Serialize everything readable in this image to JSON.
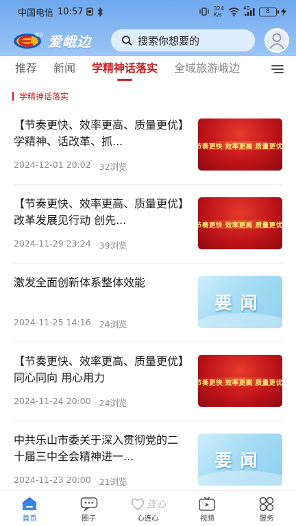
{
  "status_bar": {
    "carrier": "中国电信",
    "time": "10:57",
    "network_speed_top": "324",
    "network_speed_bottom": "K/s",
    "signal_label": "4G",
    "battery": "8"
  },
  "app": {
    "logo_text": "爱峨边",
    "search_placeholder": "搜索你想要的"
  },
  "tabs": [
    {
      "label": "推荐"
    },
    {
      "label": "新闻"
    },
    {
      "label": "学精神话落实"
    },
    {
      "label": "全域旅游峨边"
    }
  ],
  "section": {
    "title": "学精神话落实"
  },
  "articles": [
    {
      "title": "【节奏更快、效率更高、质量更优】学精神、话改革、抓...",
      "date": "2024-12-01 20:02",
      "views": "32浏览",
      "thumb_text": "节奏更快  效率更高  质量更优"
    },
    {
      "title": "【节奏更快、效率更高、质量更优】改革发展见行动 创先...",
      "date": "2024-11-29 23:24",
      "views": "39浏览",
      "thumb_text": "节奏更快  效率更高  质量更优"
    },
    {
      "title": "激发全面创新体系整体效能",
      "date": "2024-11-25 14:16",
      "views": "24浏览",
      "thumb_text": "要闻"
    },
    {
      "title": "【节奏更快、效率更高、质量更优】同心同向 用心用力",
      "date": "2024-11-24 20:00",
      "views": "24浏览",
      "thumb_text": "节奏更快  效率更高  质量更优"
    },
    {
      "title": "中共乐山市委关于深入贯彻党的二十届三中全会精神进一...",
      "date": "2024-11-23 20:00",
      "views": "21浏览",
      "thumb_text": "要闻"
    }
  ],
  "bottom_nav": [
    {
      "label": "首页",
      "icon": "home-icon"
    },
    {
      "label": "圈子",
      "icon": "chat-icon"
    },
    {
      "label": "心连心",
      "icon": "heart-connect-icon",
      "logo_text": "连心"
    },
    {
      "label": "视频",
      "icon": "video-icon"
    },
    {
      "label": "服务",
      "icon": "services-icon"
    }
  ],
  "colors": {
    "accent_red": "#c81e1e",
    "nav_active_blue": "#2b6fd6",
    "header_blue": "#6fa8ef"
  }
}
